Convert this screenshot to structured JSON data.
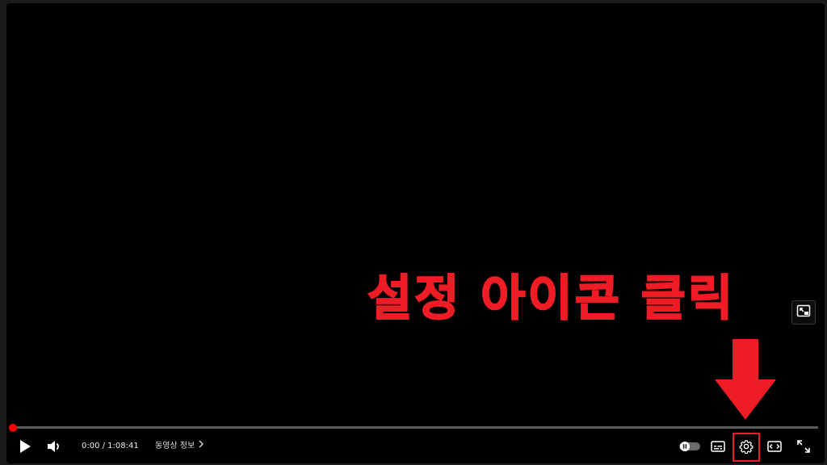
{
  "annotation": {
    "text": "설정 아이콘 클릭",
    "color": "#ee1c25"
  },
  "player": {
    "progress": 0.004,
    "progress_color": "#ff0000",
    "time_current": "0:00",
    "time_separator": "/",
    "time_total": "1:08:41",
    "time_display": "0:00 / 1:08:41",
    "video_info_label": "동영상 정보"
  },
  "controls": {
    "play": {
      "icon": "play-icon"
    },
    "volume": {
      "icon": "volume-icon"
    },
    "autoplay": {
      "icon": "autoplay-toggle-icon",
      "state": "paused"
    },
    "subtitles": {
      "icon": "subtitles-icon"
    },
    "settings": {
      "icon": "gear-icon",
      "highlighted": true
    },
    "theater": {
      "icon": "theater-mode-icon"
    },
    "fullscreen": {
      "icon": "fullscreen-icon"
    },
    "miniplayer": {
      "icon": "miniplayer-icon"
    }
  }
}
